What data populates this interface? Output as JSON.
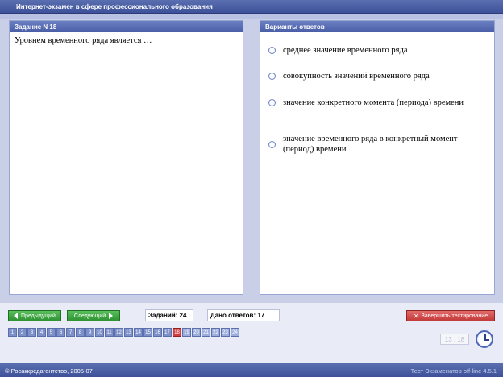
{
  "app": {
    "title": "Интернет-экзамен в сфере профессионального образования"
  },
  "question_panel": {
    "header": "Задание N 18",
    "text": "Уровнем временного ряда является …"
  },
  "answers_panel": {
    "header": "Варианты ответов",
    "options": [
      "среднее значение временного ряда",
      "совокупность значений временного ряда",
      "значение конкретного момента (периода) времени",
      "значение временного ряда в конкретный момент (период) времени"
    ]
  },
  "controls": {
    "prev_label": "Предыдущий",
    "next_label": "Следующий",
    "tasks_count": "Заданий: 24",
    "answers_given": "Дано ответов: 17",
    "finish_label": "Завершить тестирование"
  },
  "task_nav": {
    "numbers": [
      "1",
      "2",
      "3",
      "4",
      "5",
      "6",
      "7",
      "8",
      "9",
      "10",
      "11",
      "12",
      "13",
      "14",
      "15",
      "16",
      "17",
      "18",
      "19",
      "20",
      "21",
      "22",
      "23",
      "24"
    ],
    "current": "18"
  },
  "timer": {
    "value": "13 : 18"
  },
  "statusbar": {
    "left": "© Росаккредагентство, 2005-07",
    "right": "Тест Экзаменатор off-line 4.5.1"
  },
  "colors": {
    "title_bar": "#4a5ea8",
    "nav_button": "#2e9233",
    "finish_button": "#c33a3a",
    "current_task": "#d23c3c"
  }
}
